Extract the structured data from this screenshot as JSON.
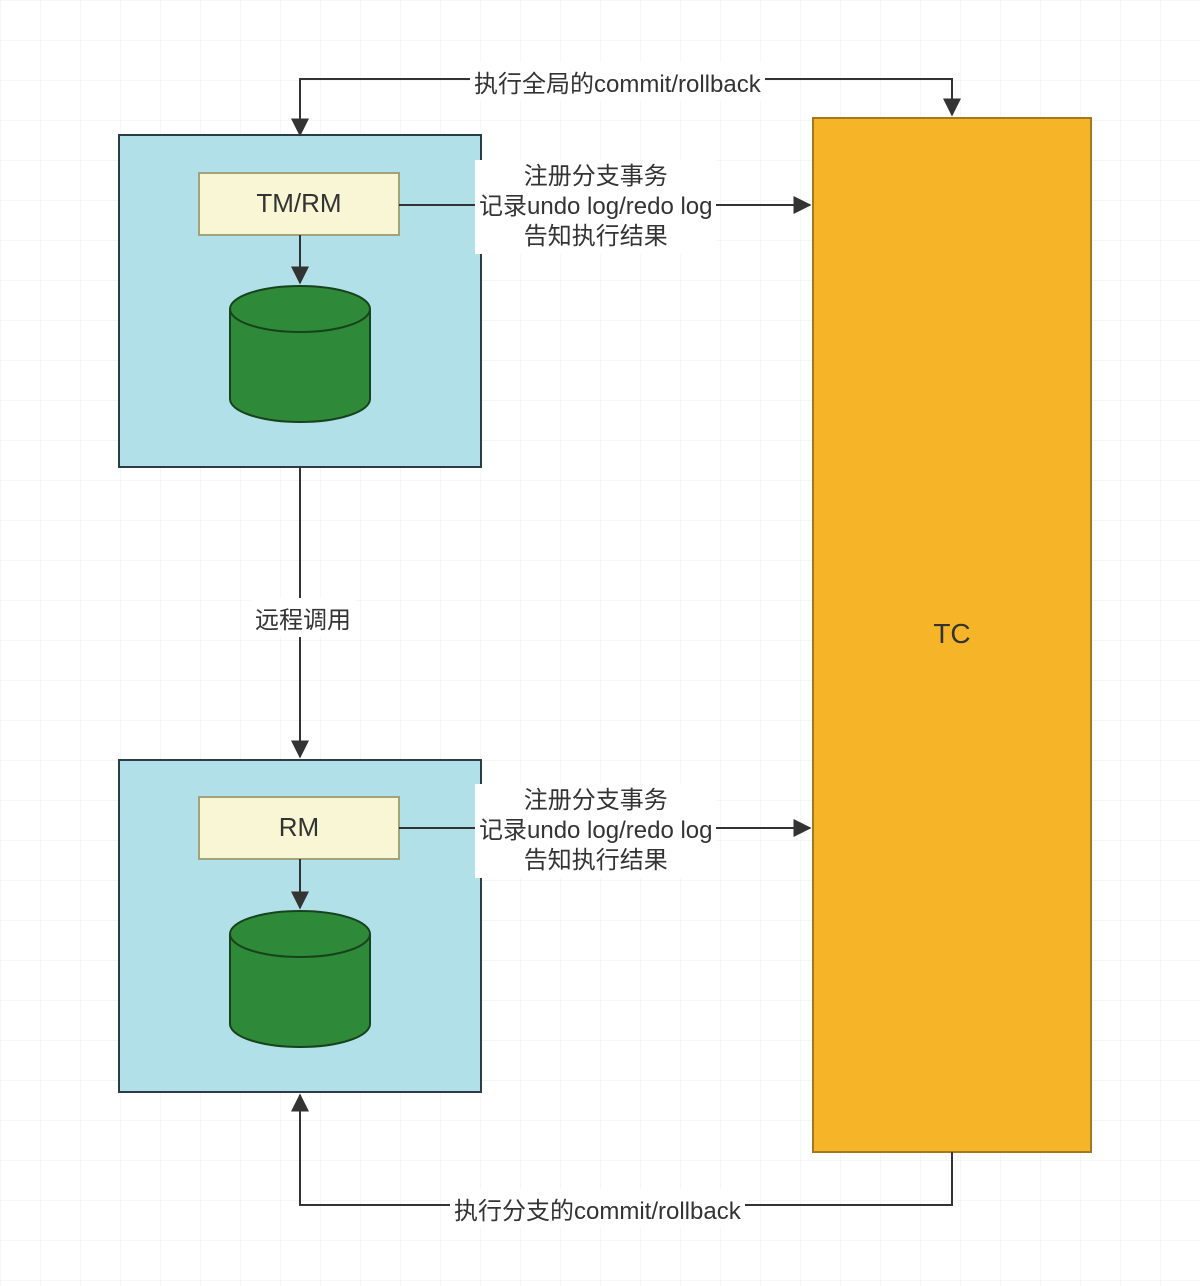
{
  "nodes": {
    "tm_rm": "TM/RM",
    "rm": "RM",
    "tc": "TC"
  },
  "edges": {
    "top_global": "执行全局的commit/rollback",
    "register1_line1": "注册分支事务",
    "register1_line2": "记录undo log/redo log",
    "register1_line3": "告知执行结果",
    "remote_call": "远程调用",
    "register2_line1": "注册分支事务",
    "register2_line2": "记录undo log/redo log",
    "register2_line3": "告知执行结果",
    "bottom_branch": "执行分支的commit/rollback"
  },
  "colors": {
    "box_blue_fill": "#b1e0e8",
    "box_blue_stroke": "#2b3d47",
    "box_yellow_fill": "#f9f6d5",
    "box_yellow_stroke": "#a3a37a",
    "db_fill": "#2e8a38",
    "db_stroke": "#18421c",
    "tc_fill": "#f6b529",
    "tc_stroke": "#a37a1b",
    "arrow": "#333333"
  }
}
